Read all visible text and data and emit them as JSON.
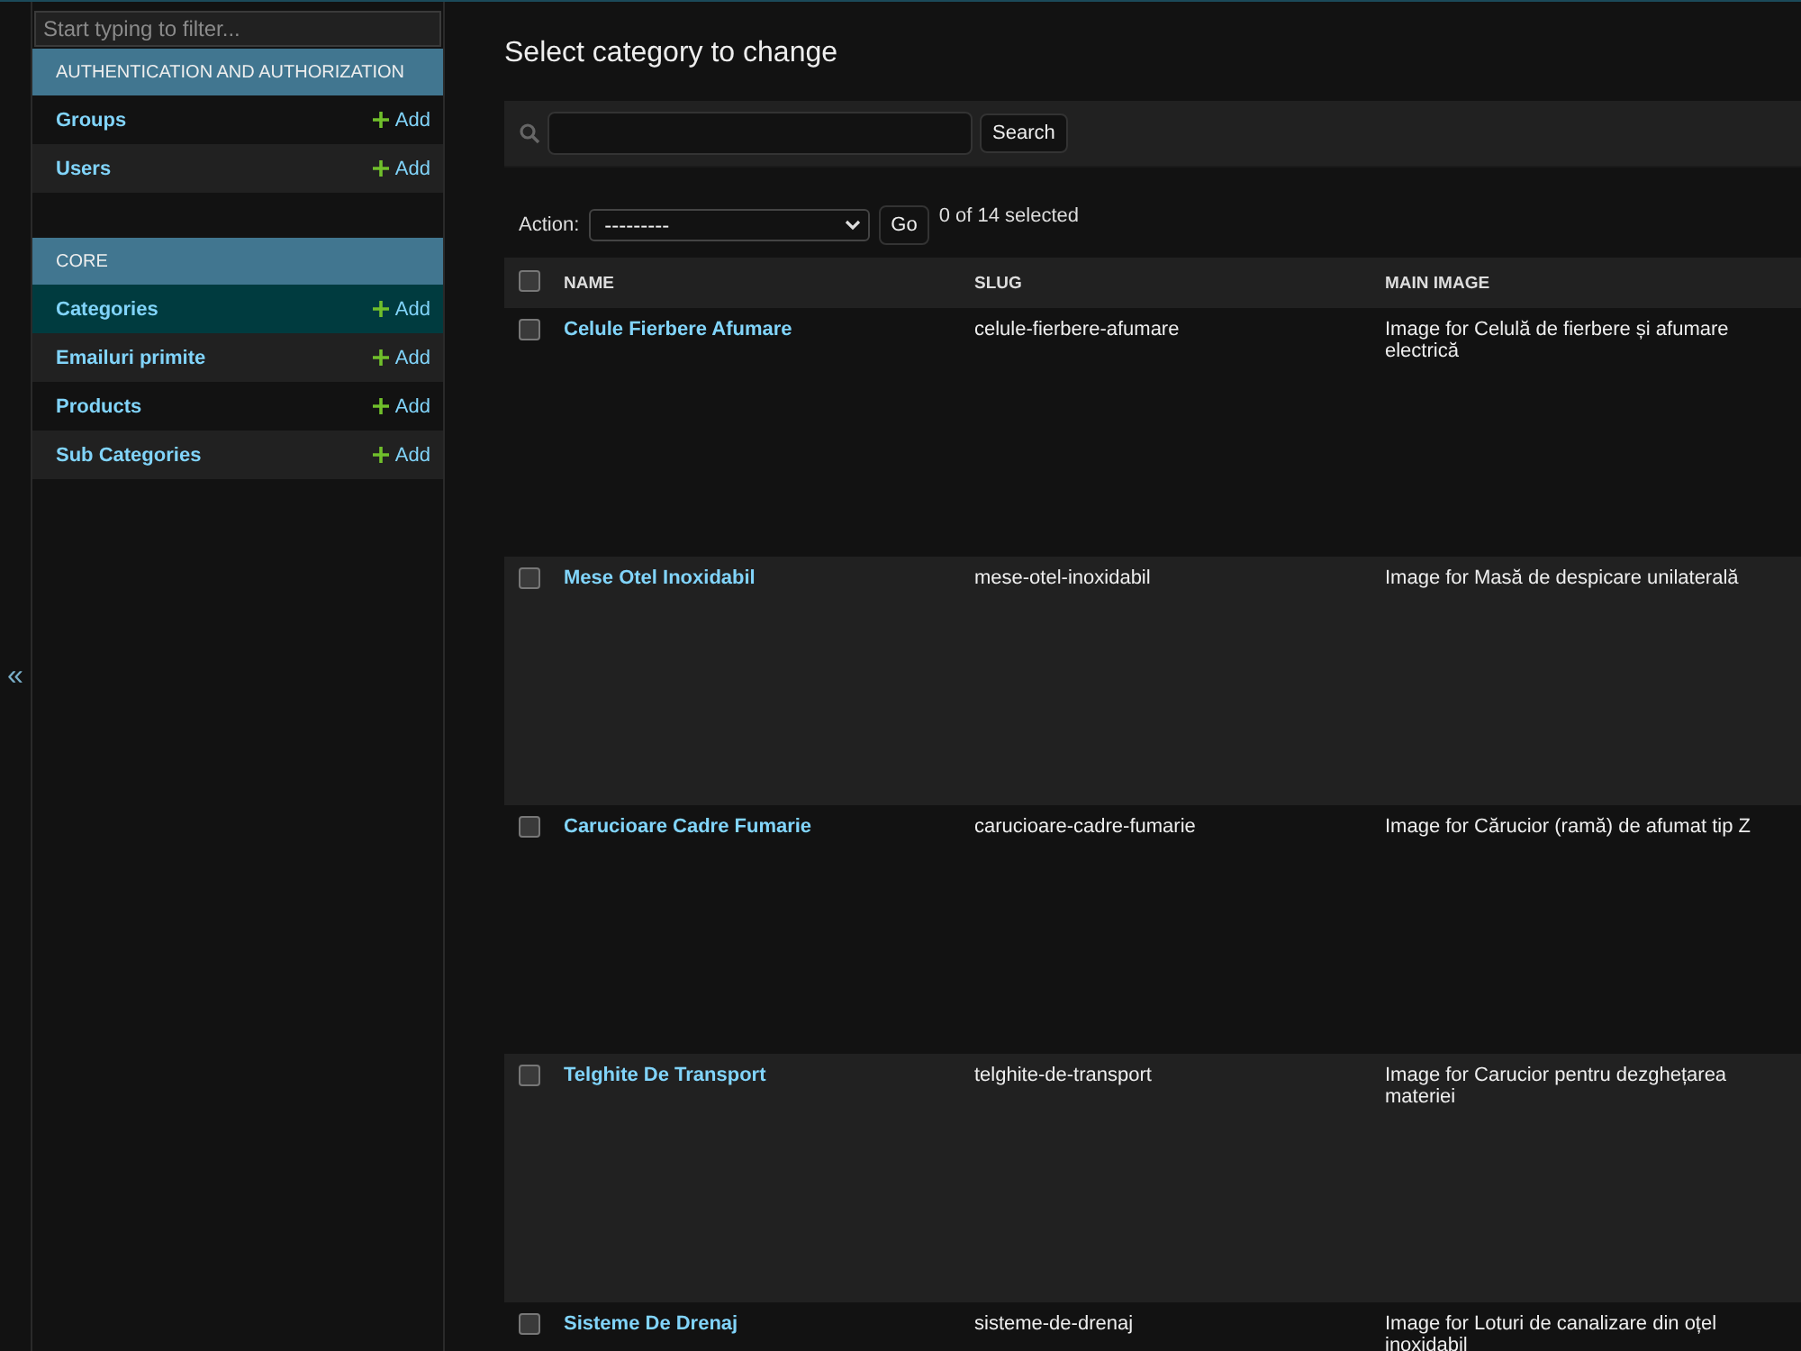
{
  "sidebar": {
    "toggle": "«",
    "filter": {
      "placeholder": "Start typing to filter..."
    },
    "apps": [
      {
        "title": "AUTHENTICATION AND AUTHORIZATION",
        "models": [
          {
            "name": "Groups",
            "add": "Add",
            "selected": false
          },
          {
            "name": "Users",
            "add": "Add",
            "selected": false
          }
        ]
      },
      {
        "title": "CORE",
        "models": [
          {
            "name": "Categories",
            "add": "Add",
            "selected": true
          },
          {
            "name": "Emailuri primite",
            "add": "Add",
            "selected": false
          },
          {
            "name": "Products",
            "add": "Add",
            "selected": false
          },
          {
            "name": "Sub Categories",
            "add": "Add",
            "selected": false
          }
        ]
      }
    ]
  },
  "main": {
    "title": "Select category to change",
    "search": {
      "button": "Search"
    },
    "actions": {
      "label": "Action:",
      "value": "---------",
      "go": "Go",
      "counter": "0 of 14 selected"
    },
    "table": {
      "select_all": {
        "checked": false
      },
      "columns": [
        "NAME",
        "SLUG",
        "MAIN IMAGE"
      ],
      "rows": [
        {
          "name": "Celule Fierbere Afumare",
          "slug": "celule-fierbere-afumare",
          "image": "Image for Celulă de fierbere și afumare electrică",
          "checked": false
        },
        {
          "name": "Mese Otel Inoxidabil",
          "slug": "mese-otel-inoxidabil",
          "image": "Image for Masă de despicare unilaterală",
          "checked": false
        },
        {
          "name": "Carucioare Cadre Fumarie",
          "slug": "carucioare-cadre-fumarie",
          "image": "Image for Cărucior (ramă) de afumat tip Z",
          "checked": false
        },
        {
          "name": "Telghite De Transport",
          "slug": "telghite-de-transport",
          "image": "Image for Carucior pentru dezghețarea materiei",
          "checked": false
        },
        {
          "name": "Sisteme De Drenaj",
          "slug": "sisteme-de-drenaj",
          "image": "Image for Loturi de canalizare din oțel inoxidabil",
          "checked": false
        }
      ]
    }
  }
}
